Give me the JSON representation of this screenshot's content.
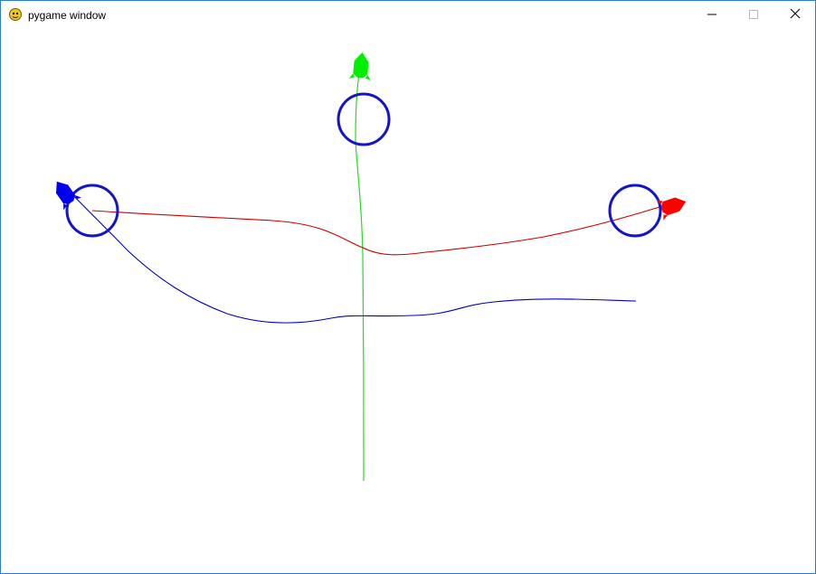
{
  "window": {
    "title": "pygame window",
    "app_icon": "pygame-snake-icon",
    "controls": {
      "minimize_icon": "minimize-icon",
      "maximize_icon": "maximize-icon",
      "close_icon": "close-icon"
    }
  },
  "scene": {
    "background": "#ffffff",
    "targets": [
      {
        "name": "target-left",
        "color": "#1414c8"
      },
      {
        "name": "target-top",
        "color": "#1414c8"
      },
      {
        "name": "target-right",
        "color": "#1414c8"
      }
    ],
    "rockets": [
      {
        "name": "rocket-blue",
        "color": "#0000ff",
        "trail_color": "#0000c0"
      },
      {
        "name": "rocket-green",
        "color": "#00ff00",
        "trail_color": "#00e000"
      },
      {
        "name": "rocket-red",
        "color": "#ff0000",
        "trail_color": "#d00000"
      }
    ]
  }
}
